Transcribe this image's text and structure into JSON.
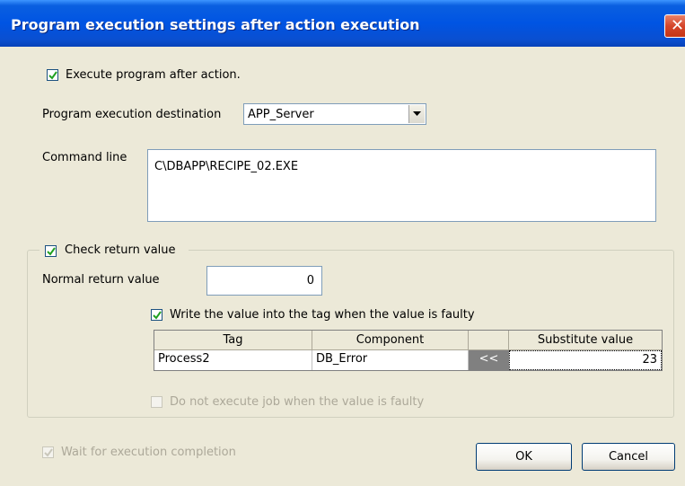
{
  "window": {
    "title": "Program execution settings after action execution"
  },
  "execute_after_action": {
    "label": "Execute program after action.",
    "checked": true
  },
  "destination": {
    "label": "Program execution destination",
    "value": "APP_Server"
  },
  "command_line": {
    "label": "Command line",
    "value": "C\\DBAPP\\RECIPE_02.EXE"
  },
  "check_return": {
    "label": "Check return value",
    "checked": true,
    "normal_label": "Normal return value",
    "normal_value": "0",
    "write_label": "Write the value into the tag when the value is faulty",
    "write_checked": true,
    "table": {
      "headers": [
        "Tag",
        "Component",
        "",
        "Substitute value"
      ],
      "row": {
        "tag": "Process2",
        "component": "DB_Error",
        "button": "<<",
        "substitute": "23"
      }
    },
    "no_job_label": "Do not execute job when the value is faulty",
    "no_job_checked": false
  },
  "wait_completion": {
    "label": "Wait for execution completion",
    "checked": true
  },
  "buttons": {
    "ok": "OK",
    "cancel": "Cancel"
  }
}
